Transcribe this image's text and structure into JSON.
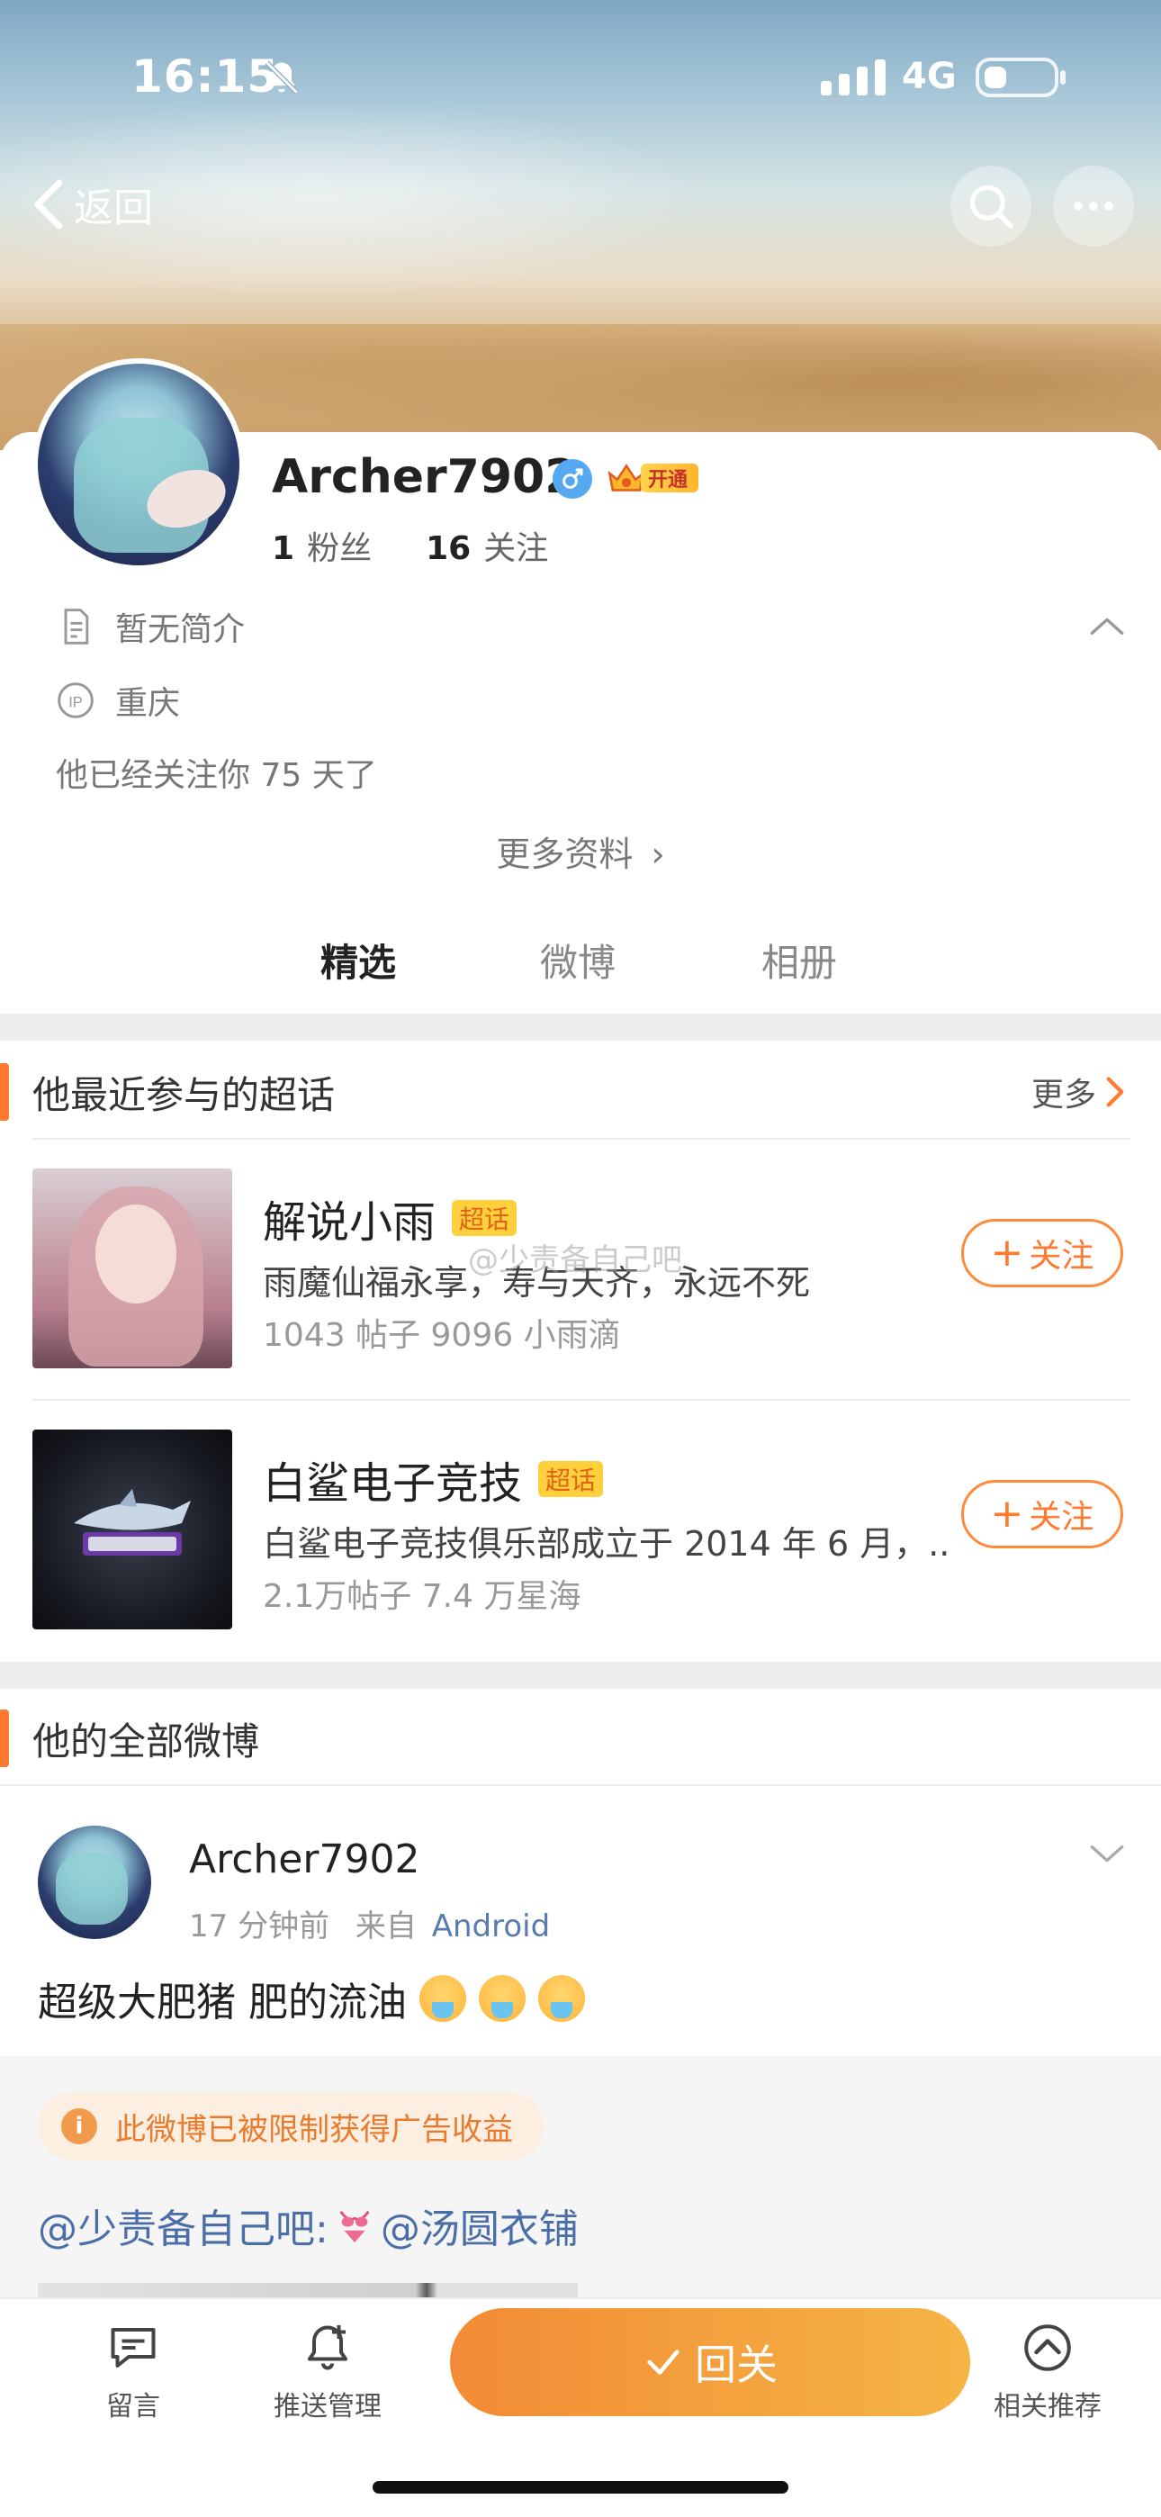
{
  "status_bar": {
    "time": "16:15",
    "network": "4G"
  },
  "nav": {
    "back_label": "返回"
  },
  "profile": {
    "username": "Archer7902",
    "vip_label": "开通",
    "fans_count": "1",
    "fans_label": "粉丝",
    "following_count": "16",
    "following_label": "关注",
    "bio": "暂无简介",
    "ip_location": "重庆",
    "follow_duration": "他已经关注你 75 天了",
    "more_info": "更多资料"
  },
  "tabs": [
    {
      "label": "精选",
      "active": true
    },
    {
      "label": "微博",
      "active": false
    },
    {
      "label": "相册",
      "active": false
    }
  ],
  "super_topics": {
    "title": "他最近参与的超话",
    "more_label": "更多",
    "tag": "超话",
    "follow_label": "关注",
    "items": [
      {
        "name": "解说小雨",
        "desc": "雨魔仙福永享，寿与天齐，永远不死",
        "stats": "1043 帖子 9096 小雨滴"
      },
      {
        "name": "白鲨电子竞技",
        "desc": "白鲨电子竞技俱乐部成立于 2014 年 6 月，..",
        "stats": "2.1万帖子 7.4 万星海"
      }
    ],
    "watermark": "@少责备自己吧"
  },
  "all_posts": {
    "title": "他的全部微博",
    "post": {
      "user": "Archer7902",
      "time": "17 分钟前",
      "from_label": "来自",
      "source": "Android",
      "text": "超级大肥猪 肥的流油",
      "warning": "此微博已被限制获得广告收益",
      "mention_1": "@少责备自己吧:",
      "mention_2": "@汤圆衣铺"
    }
  },
  "bottom_bar": {
    "comment_label": "留言",
    "push_label": "推送管理",
    "cta_label": "回关",
    "recommend_label": "相关推荐"
  },
  "colors": {
    "accent": "#ff7a2e",
    "link": "#4a6ea8",
    "male": "#56a8f0"
  }
}
